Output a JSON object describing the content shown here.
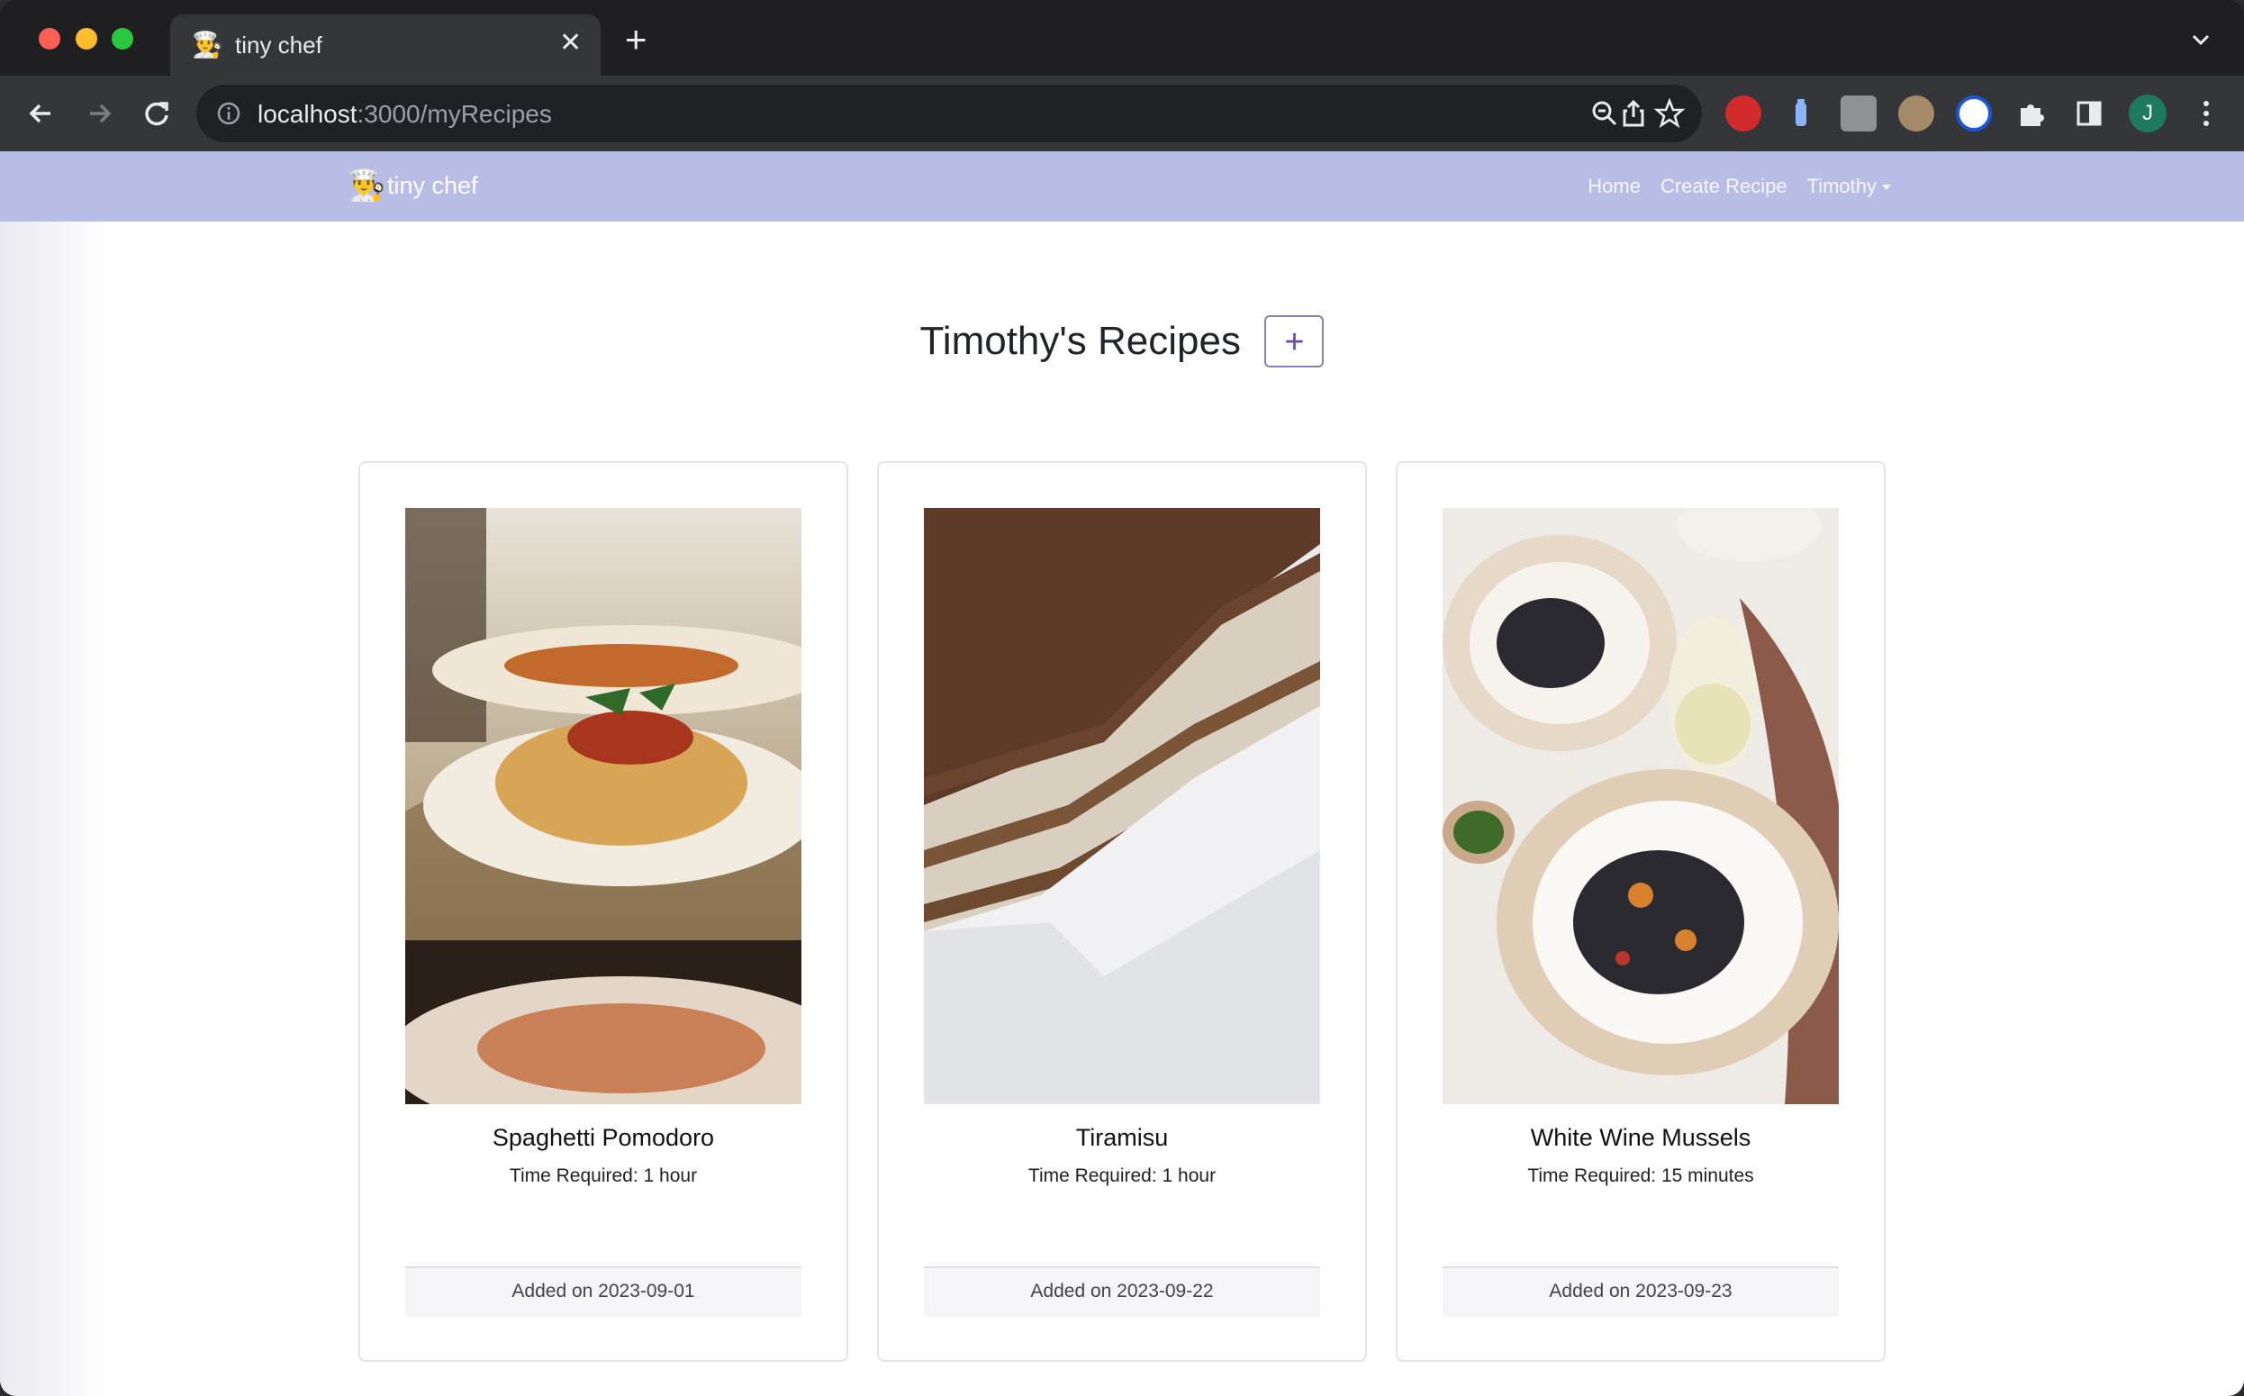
{
  "browser": {
    "tab": {
      "title": "tiny chef",
      "favicon": "chef-emoji"
    },
    "address": {
      "host": "localhost",
      "path": ":3000/myRecipes"
    },
    "profile_initial": "J",
    "colors": {
      "frame": "#1f1f22",
      "toolbar": "#35363a"
    }
  },
  "navbar": {
    "brand": "tiny chef",
    "links": {
      "home": "Home",
      "create": "Create Recipe",
      "user": "Timothy"
    },
    "color": "#b8bde6"
  },
  "main": {
    "heading": "Timothy's Recipes",
    "add_label": "+"
  },
  "recipes": [
    {
      "title": "Spaghetti Pomodoro",
      "time": "Time Required: 1 hour",
      "added": "Added on 2023-09-01",
      "image": "spaghetti-photo"
    },
    {
      "title": "Tiramisu",
      "time": "Time Required: 1 hour",
      "added": "Added on 2023-09-22",
      "image": "tiramisu-photo"
    },
    {
      "title": "White Wine Mussels",
      "time": "Time Required: 15 minutes",
      "added": "Added on 2023-09-23",
      "image": "mussels-photo"
    }
  ]
}
